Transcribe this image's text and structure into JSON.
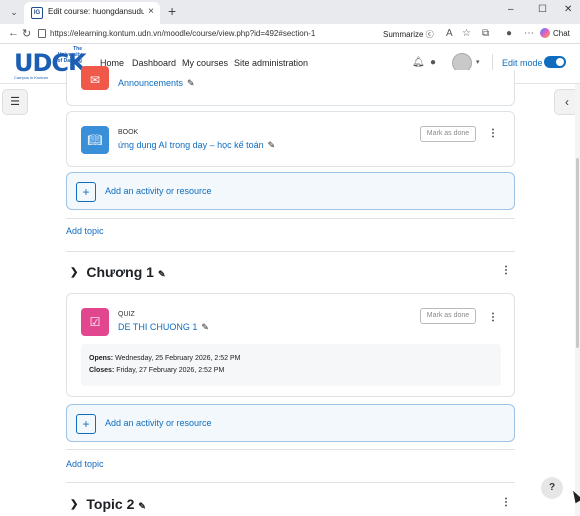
{
  "browser": {
    "tab_title": "Edit course: huongdansudung | Elc",
    "url": "https://elearning.kontum.udn.vn/moodle/course/view.php?id=492#section-1",
    "summarize_label": "Summarize",
    "chat_label": "Chat",
    "new_tab": "+",
    "tab_close": "×",
    "minimize": "–",
    "maximize": "☐",
    "close": "✕"
  },
  "logo": {
    "main": "UDCK",
    "top": "The University of Danang",
    "bottom": "Campus in Kontum"
  },
  "nav": {
    "items": [
      "Home",
      "Dashboard",
      "My courses",
      "Site administration"
    ],
    "edit_mode_label": "Edit mode"
  },
  "activities": {
    "announcements": {
      "name": "Announcements"
    },
    "book": {
      "type": "BOOK",
      "name": "ứng dụng AI trong dạy – học kế toán",
      "mark_done": "Mark as done"
    },
    "quiz": {
      "type": "QUIZ",
      "name": "DE THI CHUONG 1",
      "mark_done": "Mark as done"
    }
  },
  "quiz_dates": {
    "opens_label": "Opens:",
    "opens_value": " Wednesday, 25 February 2026, 2:52 PM",
    "closes_label": "Closes:",
    "closes_value": " Friday, 27 February 2026, 2:52 PM"
  },
  "add_activity_label": "Add an activity or resource",
  "add_topic_label": "Add topic",
  "sections": [
    {
      "title": "Chương 1"
    },
    {
      "title": "Topic 2"
    }
  ],
  "help_label": "?",
  "colors": {
    "link": "#0f6cbf",
    "book_icon": "#3a8fd9",
    "quiz_icon": "#e1468f",
    "announcement_icon": "#f0584a"
  }
}
